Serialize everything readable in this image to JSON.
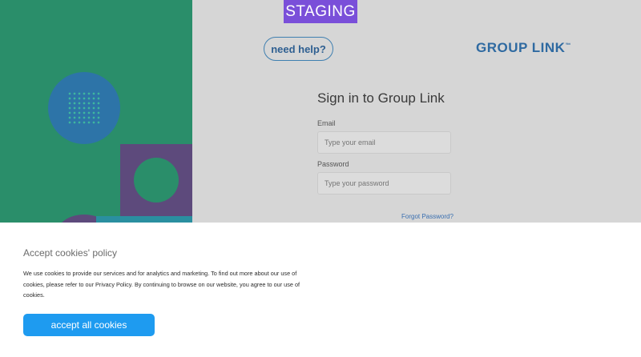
{
  "env_badge": "STAGING",
  "header": {
    "help_button": "need help?",
    "logo_text": "GROUP LINK",
    "logo_tm": "™"
  },
  "form": {
    "title": "Sign in to Group Link",
    "email_label": "Email",
    "email_placeholder": "Type your email",
    "password_label": "Password",
    "password_placeholder": "Type your password",
    "forgot_link": "Forgot Password?"
  },
  "cookie": {
    "title": "Accept cookies' policy",
    "text": "We use cookies to provide our services and for analytics and marketing. To find out more about our use of cookies, please refer to our Privacy Policy. By continuing to browse on our website, you agree to our use of cookies.",
    "accept_button": "accept all cookies"
  },
  "colors": {
    "left_panel": "#2a8e6a",
    "staging_badge": "#7a4fd9",
    "accept_button": "#1e9bf0",
    "logo": "#2f6aa1"
  }
}
